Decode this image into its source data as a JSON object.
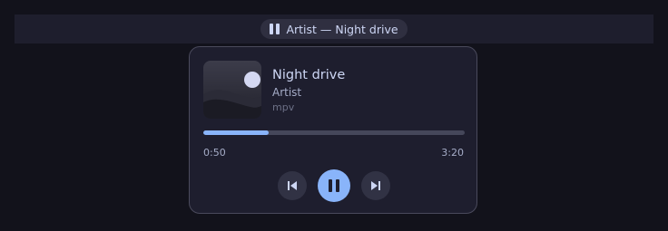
{
  "tray": {
    "pill_label": "Artist — Night drive",
    "status_icon": "pause-icon"
  },
  "popup": {
    "title": "Night drive",
    "artist": "Artist",
    "player": "mpv",
    "elapsed": "0:50",
    "total": "3:20",
    "progress_fraction": 0.25
  },
  "controls": {
    "previous_icon": "skip-previous-icon",
    "play_pause_icon": "pause-icon",
    "next_icon": "skip-next-icon"
  },
  "colors": {
    "accent": "#89b4fa",
    "background": "#12121b",
    "surface": "#1e1e2e"
  }
}
